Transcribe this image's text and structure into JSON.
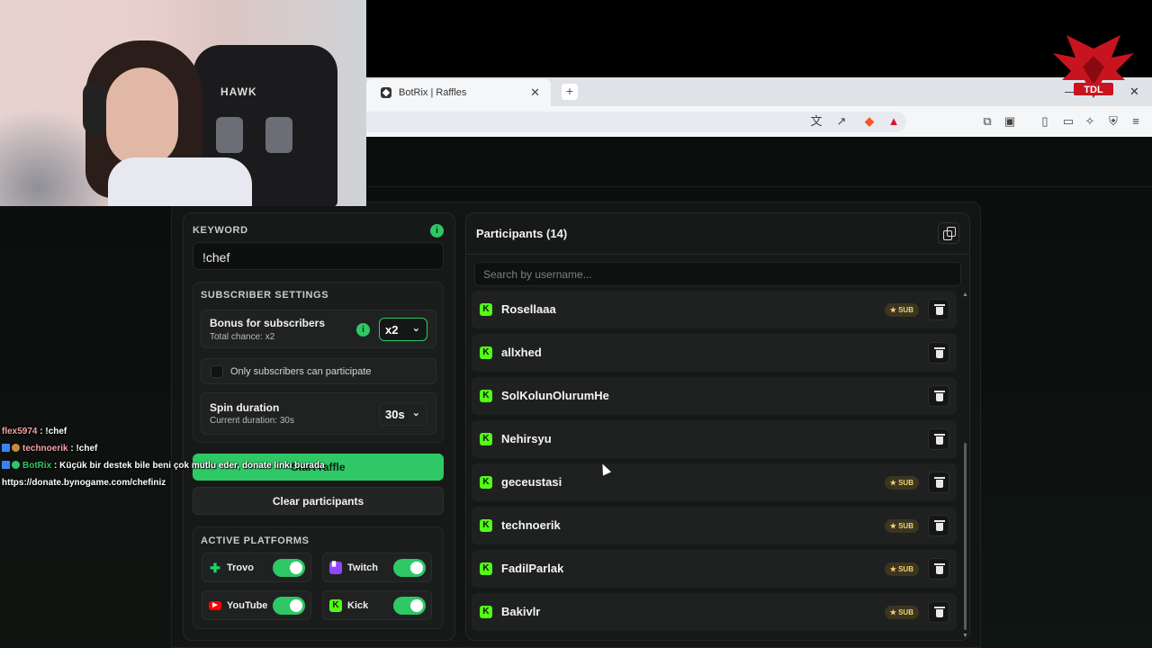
{
  "browser": {
    "tab_title": "BotRix | Raffles",
    "tab_close": "✕",
    "new_tab": "+",
    "min": "—",
    "close": "✕"
  },
  "left": {
    "keyword_label": "KEYWORD",
    "keyword_value": "!chef",
    "subscriber_settings_label": "SUBSCRIBER SETTINGS",
    "bonus_title": "Bonus for subscribers",
    "bonus_sub": "Total chance: x2",
    "bonus_value": "x2",
    "only_subs_label": "Only subscribers can participate",
    "spin_title": "Spin duration",
    "spin_sub": "Current duration: 30s",
    "spin_value": "30s",
    "start_label": "Start raffle",
    "clear_label": "Clear participants",
    "platforms_label": "ACTIVE PLATFORMS",
    "platforms": [
      {
        "name": "Trovo",
        "on": true,
        "color": "#19d66b"
      },
      {
        "name": "Twitch",
        "on": true,
        "color": "#9146ff"
      },
      {
        "name": "YouTube",
        "on": true,
        "color": "#ff0000"
      },
      {
        "name": "Kick",
        "on": true,
        "color": "#53fc18"
      }
    ]
  },
  "right": {
    "title": "Participants (14)",
    "search_placeholder": "Search by username...",
    "participants": [
      {
        "name": "Rosellaaa",
        "sub": true
      },
      {
        "name": "allxhed",
        "sub": false
      },
      {
        "name": "SolKolunOlurumHe",
        "sub": false
      },
      {
        "name": "Nehirsyu",
        "sub": false
      },
      {
        "name": "geceustasi",
        "sub": true
      },
      {
        "name": "technoerik",
        "sub": true
      },
      {
        "name": "FadilParlak",
        "sub": true
      },
      {
        "name": "Bakivlr",
        "sub": true
      }
    ],
    "sub_badge": "★ SUB"
  },
  "chat": {
    "m1_user": "flex5974",
    "m1_text": " : !chef",
    "m2_user": "technoerik",
    "m2_text": " : !chef",
    "m3_user": "BotRix",
    "m3_text": " : Küçük bir destek bile beni çok mutlu eder, donate linki burada",
    "m3_link": "https://donate.bynogame.com/chefiniz"
  },
  "webcam": {
    "chair_logo": "HAWK"
  },
  "colors": {
    "accent": "#2ec866",
    "kick": "#53fc18",
    "sub_badge": "#f1d36b"
  }
}
